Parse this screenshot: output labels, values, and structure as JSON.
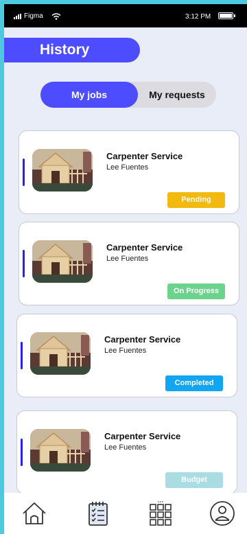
{
  "status_bar": {
    "carrier": "Figma",
    "time": "3:12 PM"
  },
  "header": {
    "title": "History"
  },
  "segment": {
    "active": "My jobs",
    "inactive": "My requests"
  },
  "jobs": [
    {
      "title": "Carpenter Service",
      "person": "Lee Fuentes",
      "status": "Pending",
      "status_color": "#f2b90f"
    },
    {
      "title": "Carpenter Service",
      "person": "Lee Fuentes",
      "status": "On Progress",
      "status_color": "#6bd38c"
    },
    {
      "title": "Carpenter Service",
      "person": "Lee Fuentes",
      "status": "Completed",
      "status_color": "#12a5f2"
    },
    {
      "title": "Carpenter Service",
      "person": "Lee Fuentes",
      "status": "Budget",
      "status_color": "#a9dde3"
    }
  ],
  "nav": {
    "items": [
      "home-icon",
      "clipboard-list-icon",
      "grid-menu-icon",
      "profile-icon"
    ]
  },
  "colors": {
    "accent": "#4d4dff",
    "frame": "#4fc9e0",
    "background": "#e8edf8"
  }
}
